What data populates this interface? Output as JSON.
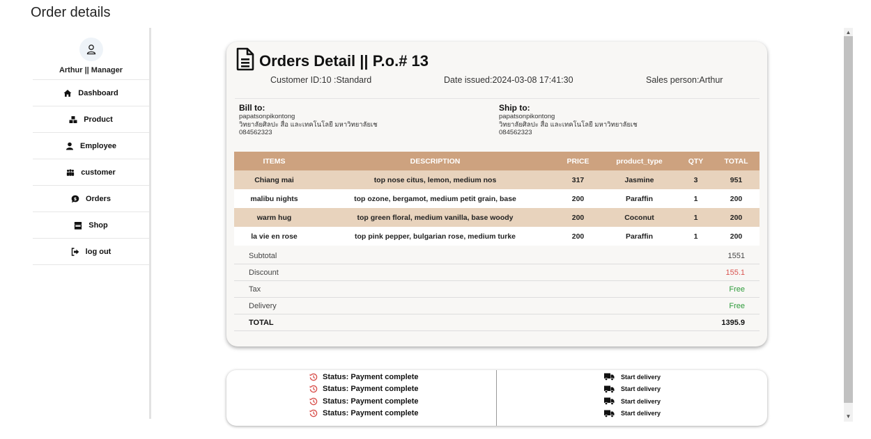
{
  "page": {
    "title": "Order details"
  },
  "sidebar": {
    "user": "Arthur || Manager",
    "items": [
      {
        "label": "Dashboard",
        "icon": "home-icon"
      },
      {
        "label": "Product",
        "icon": "boxes-icon"
      },
      {
        "label": "Employee",
        "icon": "user-icon"
      },
      {
        "label": "customer",
        "icon": "people-icon"
      },
      {
        "label": "Orders",
        "icon": "chat-dollar-icon"
      },
      {
        "label": "Shop",
        "icon": "store-icon"
      },
      {
        "label": "log out",
        "icon": "logout-icon"
      }
    ]
  },
  "order": {
    "title": "Orders Detail || P.o.# 13",
    "customer": "Customer ID:10 :Standard",
    "date": "Date issued:2024-03-08 17:41:30",
    "sales": "Sales person:Arthur",
    "bill": {
      "label": "Bill to:",
      "name": "papatsonpikontong",
      "address": "วิทยาลัยศิลปะ สื่อ และเทคโนโลยี มหาวิทยาลัยเช",
      "phone": "084562323"
    },
    "ship": {
      "label": "Ship to:",
      "name": "papatsonpikontong",
      "address": "วิทยาลัยศิลปะ สื่อ และเทคโนโลยี มหาวิทยาลัยเช",
      "phone": "084562323"
    },
    "table": {
      "headers": [
        "ITEMS",
        "DESCRIPTION",
        "PRICE",
        "product_type",
        "QTY",
        "TOTAL"
      ],
      "rows": [
        [
          "Chiang mai",
          "top nose citus, lemon, medium nos",
          "317",
          "Jasmine",
          "3",
          "951"
        ],
        [
          "malibu nights",
          "top ozone, bergamot, medium petit grain, base",
          "200",
          "Paraffin",
          "1",
          "200"
        ],
        [
          "warm hug",
          "top green floral, medium vanilla, base woody",
          "200",
          "Coconut",
          "1",
          "200"
        ],
        [
          "la vie en rose",
          "top pink pepper, bulgarian rose, medium turke",
          "200",
          "Paraffin",
          "1",
          "200"
        ]
      ]
    },
    "summary": {
      "subtotal_label": "Subtotal",
      "subtotal": "1551",
      "discount_label": "Discount",
      "discount": "155.1",
      "tax_label": "Tax",
      "tax": "Free",
      "delivery_label": "Delivery",
      "delivery": "Free",
      "total_label": "TOTAL",
      "total": "1395.9"
    }
  },
  "status": {
    "left": [
      "Status: Payment complete",
      "Status: Payment complete",
      "Status: Payment complete",
      "Status: Payment complete"
    ],
    "right": [
      "Start delivery",
      "Start delivery",
      "Start delivery",
      "Start delivery"
    ]
  },
  "colors": {
    "table_header": "#cda27f",
    "row_alt": "#e8d3bd",
    "discount": "#d9534f",
    "free": "#2e9b3b",
    "history_icon": "#d9534f"
  }
}
